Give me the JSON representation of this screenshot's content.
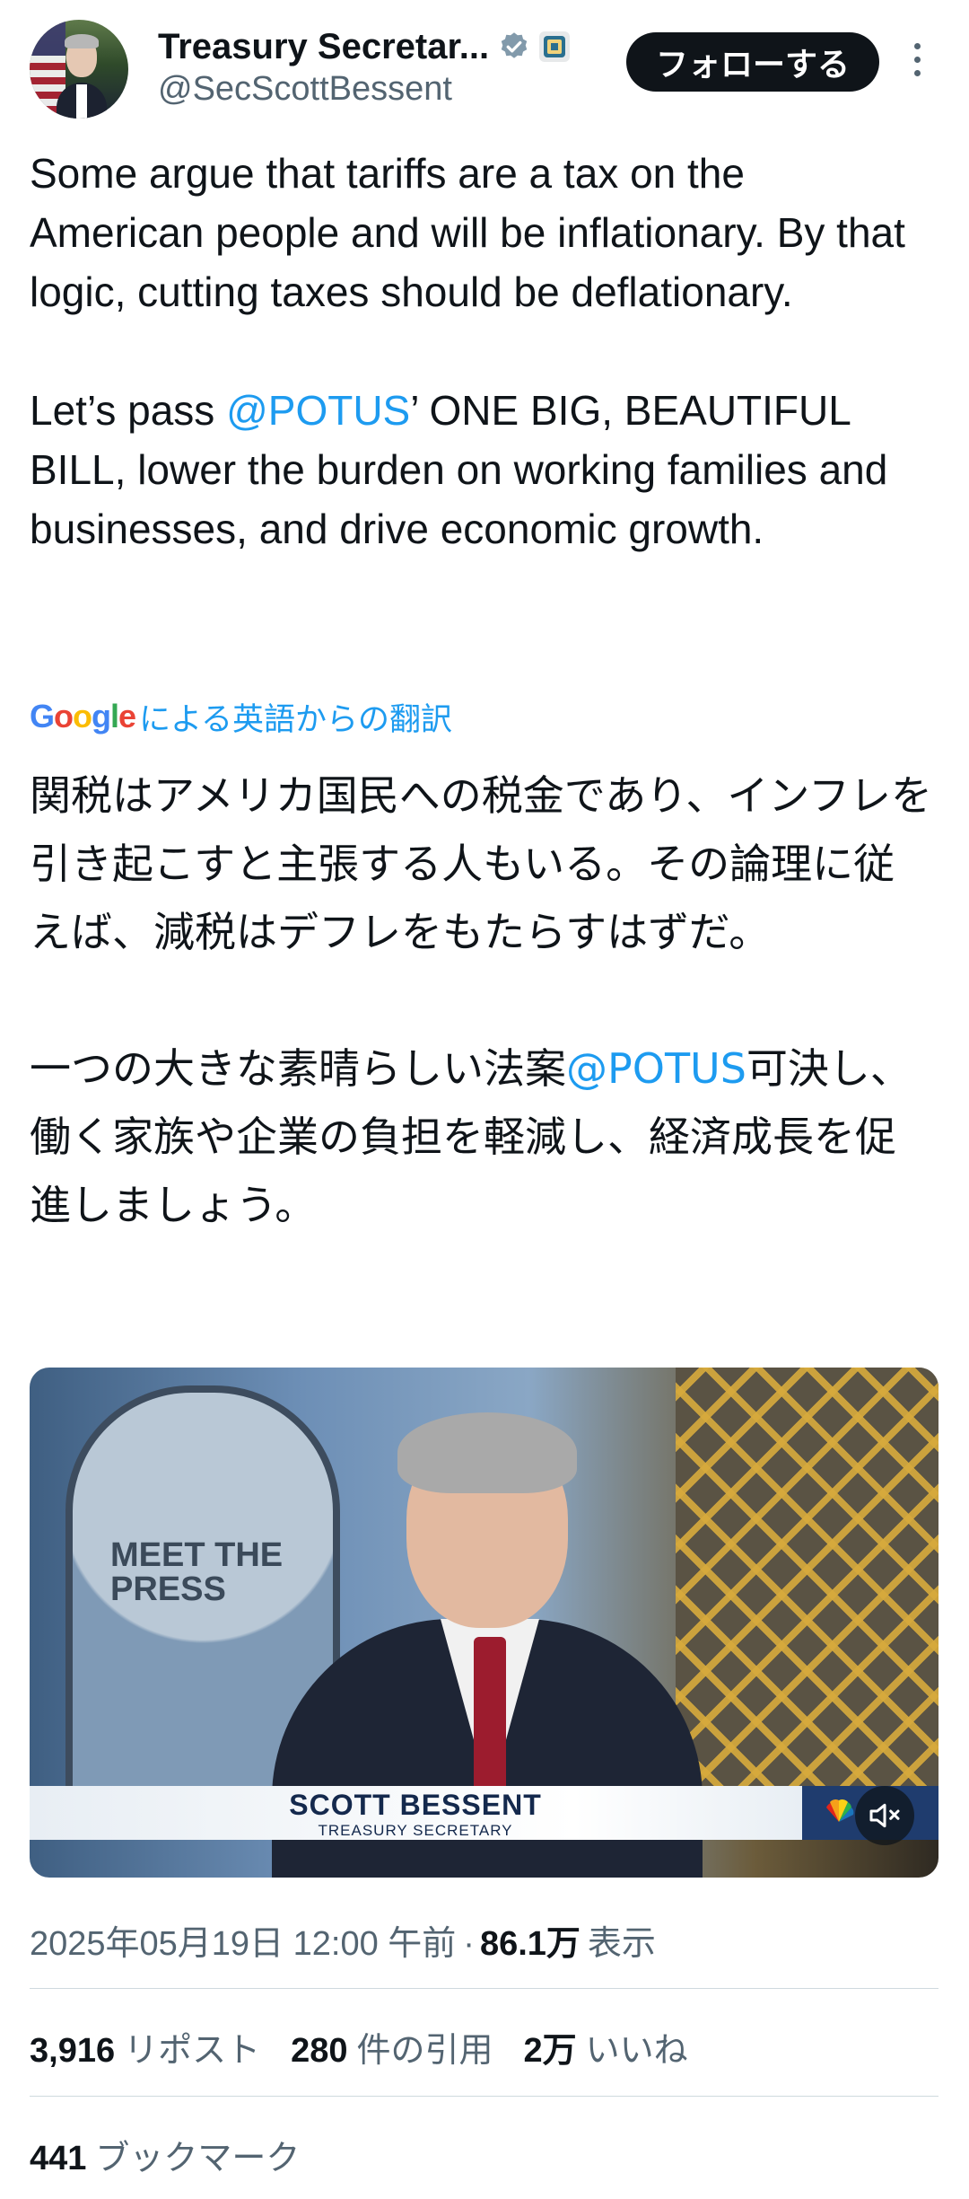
{
  "header": {
    "display_name": "Treasury Secretar...",
    "handle": "@SecScottBessent",
    "follow_label": "フォローする"
  },
  "tweet": {
    "text_en_part1": "Some argue that tariffs are a tax on the American people and will be inflationary. By that logic, cutting taxes should be deflationary.\n\nLet’s pass ",
    "mention_en": "@POTUS",
    "text_en_part2": "’ ONE BIG, BEAUTIFUL BILL, lower the burden on working families and businesses, and drive economic growth.",
    "translation_brand": "Google",
    "translation_label": "による英語からの翻訳",
    "text_jp_part1": "関税はアメリカ国民への税金であり、インフレを引き起こすと主張する人もいる。その論理に従えば、減税はデフレをもたらすはずだ。\n\n一つの大きな素晴らしい法案",
    "mention_jp": "@POTUS",
    "text_jp_part2": "可決し、働く家族や企業の負担を軽減し、経済成長を促進しましょう。"
  },
  "media": {
    "show_logo": "MEET THE PRESS",
    "lower_third_name": "SCOTT BESSENT",
    "lower_third_title": "TREASURY SECRETARY",
    "network_logo": "NBC NEWS",
    "mute_icon": "muted-speaker-icon"
  },
  "meta": {
    "timestamp": "2025年05月19日 12:00 午前",
    "separator": "·",
    "views_count": "86.1万",
    "views_label": "表示"
  },
  "stats": {
    "reposts": {
      "count": "3,916",
      "label": "リポスト"
    },
    "quotes": {
      "count": "280",
      "label": "件の引用"
    },
    "likes": {
      "count": "2万",
      "label": "いいね"
    },
    "bookmarks": {
      "count": "441",
      "label": "ブックマーク"
    }
  },
  "colors": {
    "link": "#1d9bf0",
    "text": "#0f1419",
    "secondary": "#536471",
    "follow_bg": "#0f1419"
  }
}
